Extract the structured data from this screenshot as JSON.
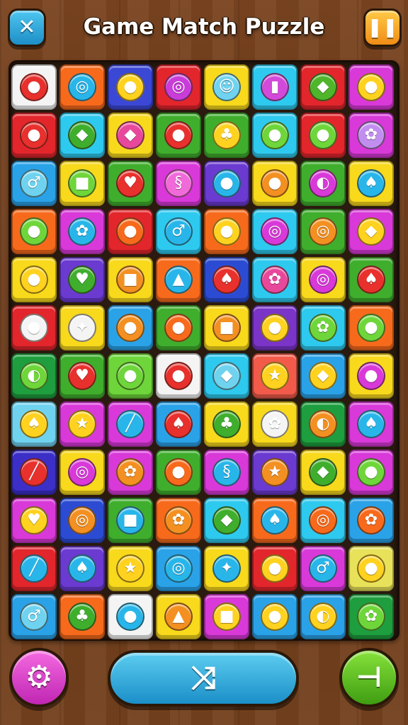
{
  "header": {
    "title": "Game Match Puzzle",
    "close_icon": "close-icon",
    "pause_icon": "pause-icon"
  },
  "board": {
    "rows": [
      [
        {
          "bg": "#f4f4f4",
          "fg": "#e8302d",
          "sym": "●"
        },
        {
          "bg": "#f76a1c",
          "fg": "#28b6ea",
          "sym": "◎"
        },
        {
          "bg": "#3b48d6",
          "fg": "#ffd21f",
          "sym": "●"
        },
        {
          "bg": "#e2262c",
          "fg": "#c93cd8",
          "sym": "◎"
        },
        {
          "bg": "#f8d91c",
          "fg": "#6fd3f0",
          "sym": "☺"
        },
        {
          "bg": "#2ec9ef",
          "fg": "#d24ad9",
          "sym": "▮"
        },
        {
          "bg": "#e2262c",
          "fg": "#4fb52a",
          "sym": "◆"
        },
        {
          "bg": "#d939d9",
          "fg": "#ffd21f",
          "sym": "●"
        }
      ],
      [
        {
          "bg": "#e2262c",
          "fg": "#e8302d",
          "sym": "●"
        },
        {
          "bg": "#2ec9ef",
          "fg": "#3fae2d",
          "sym": "◆"
        },
        {
          "bg": "#f8d91c",
          "fg": "#e8489b",
          "sym": "◆"
        },
        {
          "bg": "#3fae2d",
          "fg": "#e8302d",
          "sym": "●"
        },
        {
          "bg": "#3fae2d",
          "fg": "#ffd21f",
          "sym": "♣"
        },
        {
          "bg": "#2ec9ef",
          "fg": "#6ed63a",
          "sym": "●"
        },
        {
          "bg": "#e2262c",
          "fg": "#6ed63a",
          "sym": "●"
        },
        {
          "bg": "#d939d9",
          "fg": "#c18ef0",
          "sym": "✿"
        }
      ],
      [
        {
          "bg": "#2aa2e8",
          "fg": "#6fd3f0",
          "sym": "♂"
        },
        {
          "bg": "#f8d91c",
          "fg": "#6ed63a",
          "sym": "■"
        },
        {
          "bg": "#3fae2d",
          "fg": "#e8302d",
          "sym": "♥"
        },
        {
          "bg": "#d939d9",
          "fg": "#f06ad9",
          "sym": "§"
        },
        {
          "bg": "#6b3ad0",
          "fg": "#28b6ea",
          "sym": "●"
        },
        {
          "bg": "#f8d91c",
          "fg": "#f39021",
          "sym": "●"
        },
        {
          "bg": "#3fae2d",
          "fg": "#d939d9",
          "sym": "◐"
        },
        {
          "bg": "#f8d91c",
          "fg": "#28b6ea",
          "sym": "♠"
        }
      ],
      [
        {
          "bg": "#f76a1c",
          "fg": "#6ed63a",
          "sym": "●"
        },
        {
          "bg": "#d939d9",
          "fg": "#28b6ea",
          "sym": "✿"
        },
        {
          "bg": "#e2262c",
          "fg": "#f76a1c",
          "sym": "●"
        },
        {
          "bg": "#2ec9ef",
          "fg": "#28b6ea",
          "sym": "♂"
        },
        {
          "bg": "#f76a1c",
          "fg": "#ffd21f",
          "sym": "●"
        },
        {
          "bg": "#2ec9ef",
          "fg": "#d939d9",
          "sym": "◎"
        },
        {
          "bg": "#3fae2d",
          "fg": "#f39021",
          "sym": "◎"
        },
        {
          "bg": "#d939d9",
          "fg": "#ffd21f",
          "sym": "◆"
        }
      ],
      [
        {
          "bg": "#f8d91c",
          "fg": "#ffd21f",
          "sym": "●"
        },
        {
          "bg": "#6b3ad0",
          "fg": "#3fae2d",
          "sym": "♥"
        },
        {
          "bg": "#f8d91c",
          "fg": "#f39021",
          "sym": "■"
        },
        {
          "bg": "#f76a1c",
          "fg": "#28b6ea",
          "sym": "▲"
        },
        {
          "bg": "#2b4cd2",
          "fg": "#e8302d",
          "sym": "♠"
        },
        {
          "bg": "#2ec9ef",
          "fg": "#e8489b",
          "sym": "✿"
        },
        {
          "bg": "#f8d91c",
          "fg": "#d939d9",
          "sym": "◎"
        },
        {
          "bg": "#3fae2d",
          "fg": "#e8302d",
          "sym": "♠"
        }
      ],
      [
        {
          "bg": "#e2262c",
          "fg": "#f4f4f4",
          "sym": "●"
        },
        {
          "bg": "#f8d91c",
          "fg": "#f4f4f4",
          "sym": "✦"
        },
        {
          "bg": "#2aa2e8",
          "fg": "#f39021",
          "sym": "●"
        },
        {
          "bg": "#3fae2d",
          "fg": "#f76a1c",
          "sym": "●"
        },
        {
          "bg": "#f8d91c",
          "fg": "#f39021",
          "sym": "■"
        },
        {
          "bg": "#7a34c8",
          "fg": "#ffd21f",
          "sym": "●"
        },
        {
          "bg": "#2ec9ef",
          "fg": "#6ed63a",
          "sym": "✿"
        },
        {
          "bg": "#f76a1c",
          "fg": "#6ed63a",
          "sym": "●"
        }
      ],
      [
        {
          "bg": "#1e9e3e",
          "fg": "#6ed63a",
          "sym": "◐"
        },
        {
          "bg": "#3fae2d",
          "fg": "#e8302d",
          "sym": "♥"
        },
        {
          "bg": "#6ed63a",
          "fg": "#6ed63a",
          "sym": "●"
        },
        {
          "bg": "#f4f4f4",
          "fg": "#e8302d",
          "sym": "●"
        },
        {
          "bg": "#2ec9ef",
          "fg": "#6fd3f0",
          "sym": "◆"
        },
        {
          "bg": "#f25a4a",
          "fg": "#ffd21f",
          "sym": "★"
        },
        {
          "bg": "#2aa2e8",
          "fg": "#ffd21f",
          "sym": "◆"
        },
        {
          "bg": "#f8d91c",
          "fg": "#d939d9",
          "sym": "●"
        }
      ],
      [
        {
          "bg": "#6fd3f0",
          "fg": "#ffd21f",
          "sym": "♠"
        },
        {
          "bg": "#d939d9",
          "fg": "#ffd21f",
          "sym": "★"
        },
        {
          "bg": "#d939d9",
          "fg": "#28b6ea",
          "sym": "╱"
        },
        {
          "bg": "#2aa2e8",
          "fg": "#e8302d",
          "sym": "♠"
        },
        {
          "bg": "#f8d91c",
          "fg": "#3fae2d",
          "sym": "♣"
        },
        {
          "bg": "#f8d91c",
          "fg": "#f4f4f4",
          "sym": "✿"
        },
        {
          "bg": "#1e9e3e",
          "fg": "#f39021",
          "sym": "◐"
        },
        {
          "bg": "#d939d9",
          "fg": "#28b6ea",
          "sym": "♠"
        }
      ],
      [
        {
          "bg": "#3b2fc8",
          "fg": "#e8302d",
          "sym": "╱"
        },
        {
          "bg": "#f8d91c",
          "fg": "#d939d9",
          "sym": "◎"
        },
        {
          "bg": "#d939d9",
          "fg": "#f39021",
          "sym": "✿"
        },
        {
          "bg": "#3fae2d",
          "fg": "#f76a1c",
          "sym": "●"
        },
        {
          "bg": "#d939d9",
          "fg": "#28b6ea",
          "sym": "§"
        },
        {
          "bg": "#6b3ad0",
          "fg": "#f39021",
          "sym": "★"
        },
        {
          "bg": "#f8d91c",
          "fg": "#3fae2d",
          "sym": "◆"
        },
        {
          "bg": "#d939d9",
          "fg": "#6ed63a",
          "sym": "●"
        }
      ],
      [
        {
          "bg": "#d939d9",
          "fg": "#ffd21f",
          "sym": "♥"
        },
        {
          "bg": "#2b4cd2",
          "fg": "#f39021",
          "sym": "◎"
        },
        {
          "bg": "#3fae2d",
          "fg": "#28b6ea",
          "sym": "■"
        },
        {
          "bg": "#f76a1c",
          "fg": "#f39021",
          "sym": "✿"
        },
        {
          "bg": "#2ec9ef",
          "fg": "#3fae2d",
          "sym": "◆"
        },
        {
          "bg": "#f76a1c",
          "fg": "#28b6ea",
          "sym": "♠"
        },
        {
          "bg": "#2ec9ef",
          "fg": "#f76a1c",
          "sym": "◎"
        },
        {
          "bg": "#2aa2e8",
          "fg": "#f76a1c",
          "sym": "✿"
        }
      ],
      [
        {
          "bg": "#e2262c",
          "fg": "#28b6ea",
          "sym": "╱"
        },
        {
          "bg": "#6b3ad0",
          "fg": "#28b6ea",
          "sym": "♠"
        },
        {
          "bg": "#f8d91c",
          "fg": "#ffd21f",
          "sym": "★"
        },
        {
          "bg": "#2aa2e8",
          "fg": "#28b6ea",
          "sym": "◎"
        },
        {
          "bg": "#f8d91c",
          "fg": "#28b6ea",
          "sym": "✦"
        },
        {
          "bg": "#e2262c",
          "fg": "#ffd21f",
          "sym": "●"
        },
        {
          "bg": "#d939d9",
          "fg": "#28b6ea",
          "sym": "♂"
        },
        {
          "bg": "#e8e25a",
          "fg": "#ffd21f",
          "sym": "●"
        }
      ],
      [
        {
          "bg": "#2aa2e8",
          "fg": "#6fd3f0",
          "sym": "♂"
        },
        {
          "bg": "#f76a1c",
          "fg": "#3fae2d",
          "sym": "♣"
        },
        {
          "bg": "#f4f4f4",
          "fg": "#28b6ea",
          "sym": "●"
        },
        {
          "bg": "#f8d91c",
          "fg": "#f39021",
          "sym": "▲"
        },
        {
          "bg": "#d939d9",
          "fg": "#ffd21f",
          "sym": "■"
        },
        {
          "bg": "#2aa2e8",
          "fg": "#ffd21f",
          "sym": "●"
        },
        {
          "bg": "#2aa2e8",
          "fg": "#ffd21f",
          "sym": "◐"
        },
        {
          "bg": "#1e9e3e",
          "fg": "#6ed63a",
          "sym": "✿"
        }
      ]
    ]
  },
  "controls": {
    "settings_icon": "gear-icon",
    "shuffle_icon": "shuffle-icon",
    "confirm_icon": "hint-icon"
  },
  "colors": {
    "wood": "#6a3a1a",
    "board_border": "#2a1a0f",
    "close_blue": "#1d8ec7",
    "pause_orange": "#f08d16",
    "settings_pink": "#c026b3",
    "confirm_green": "#3f9d12"
  }
}
